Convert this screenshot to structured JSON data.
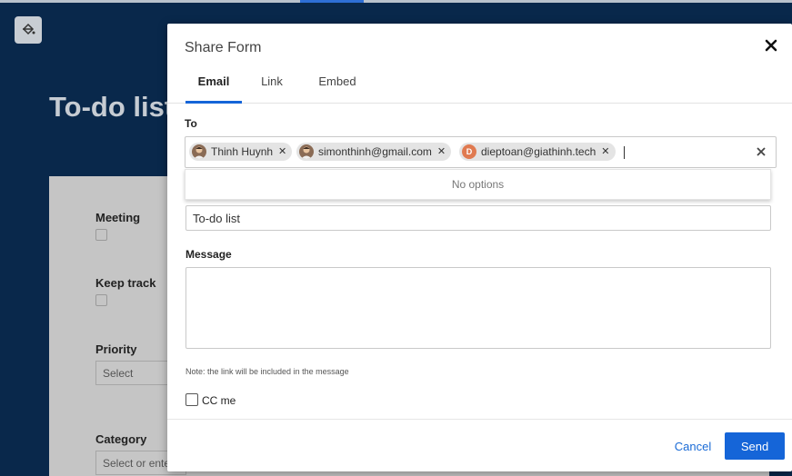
{
  "background": {
    "page_title": "To-do list",
    "fields": [
      {
        "label": "Meeting"
      },
      {
        "label": "Keep track"
      },
      {
        "label": "Priority",
        "placeholder": "Select"
      },
      {
        "label": "Category",
        "placeholder": "Select or ente"
      }
    ]
  },
  "modal": {
    "title": "Share Form",
    "tabs": [
      {
        "label": "Email",
        "active": true
      },
      {
        "label": "Link",
        "active": false
      },
      {
        "label": "Embed",
        "active": false
      }
    ],
    "to_label": "To",
    "recipients": [
      {
        "name": "Thinh Huynh",
        "avatar": "photo"
      },
      {
        "name": "simonthinh@gmail.com",
        "avatar": "photo"
      },
      {
        "name": "dieptoan@giathinh.tech",
        "avatar": "letter",
        "letter": "D"
      }
    ],
    "dropdown_text": "No options",
    "subject_value": "To-do list",
    "message_label": "Message",
    "note": "Note: the link will be included in the message",
    "cc_label": "CC me",
    "cancel_label": "Cancel",
    "send_label": "Send"
  },
  "colors": {
    "accent": "#1565d8",
    "backdrop": "#09284b"
  }
}
